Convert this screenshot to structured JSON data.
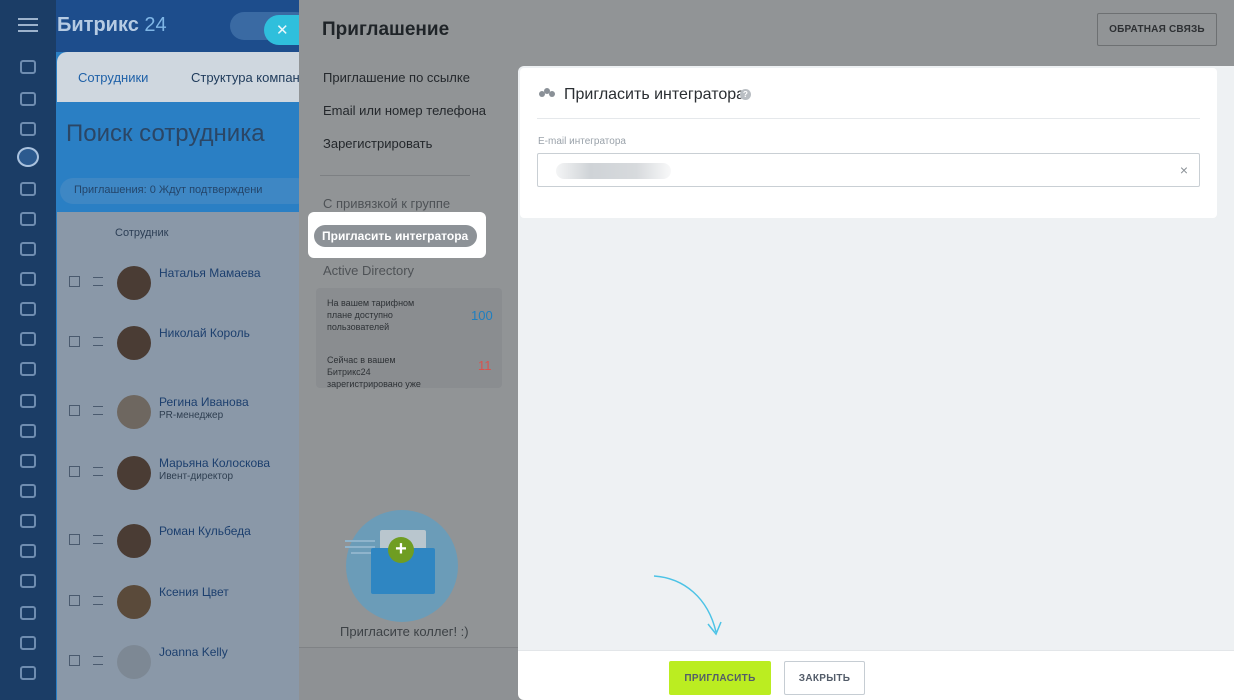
{
  "background_app": {
    "logo_text": "Битрикс",
    "logo_number": "24",
    "tabs": [
      {
        "label": "Сотрудники"
      },
      {
        "label": "Структура компан"
      }
    ],
    "page_title": "Поиск сотрудника",
    "invites_label": "Приглашения:",
    "invites_count": "0",
    "invites_pending": "Ждут подтверждени",
    "column_header": "Сотрудник",
    "employees": [
      {
        "name": "Наталья Мамаева",
        "role": ""
      },
      {
        "name": "Николай Король",
        "role": ""
      },
      {
        "name": "Регина Иванова",
        "role": "PR-менеджер"
      },
      {
        "name": "Марьяна Колоскова",
        "role": "Ивент-директор"
      },
      {
        "name": "Роман Кульбеда",
        "role": ""
      },
      {
        "name": "Ксения Цвет",
        "role": ""
      },
      {
        "name": "Joanna Kelly",
        "role": ""
      }
    ]
  },
  "slider": {
    "title": "Приглашение",
    "feedback_button": "ОБРАТНАЯ СВЯЗЬ",
    "menu": {
      "link_invite": "Приглашение по ссылке",
      "email_phone": "Email или номер телефона",
      "register": "Зарегистрировать",
      "with_group": "С привязкой к группе",
      "invite_integrator": "Пригласить интегратора",
      "active_directory": "Active Directory"
    },
    "stats": {
      "available_text": "На вашем тарифном плане доступно пользователей",
      "available_value": "100",
      "registered_text": "Сейчас в вашем Битрикс24 зарегистрировано уже",
      "registered_value": "11"
    },
    "promo_text": "Пригласите коллег! :)"
  },
  "panel": {
    "title": "Пригласить интегратора",
    "help": "?",
    "email_label": "E-mail интегратора",
    "email_value": "",
    "clear": "×"
  },
  "footer": {
    "invite_button": "ПРИГЛАСИТЬ",
    "close_button": "ЗАКРЫТЬ"
  },
  "colors": {
    "accent_green": "#bbed21",
    "highlight_pill": "#8d9297",
    "stat_blue": "#1f7fc0",
    "stat_red": "#d9534f",
    "arrow": "#4cc3e6"
  }
}
